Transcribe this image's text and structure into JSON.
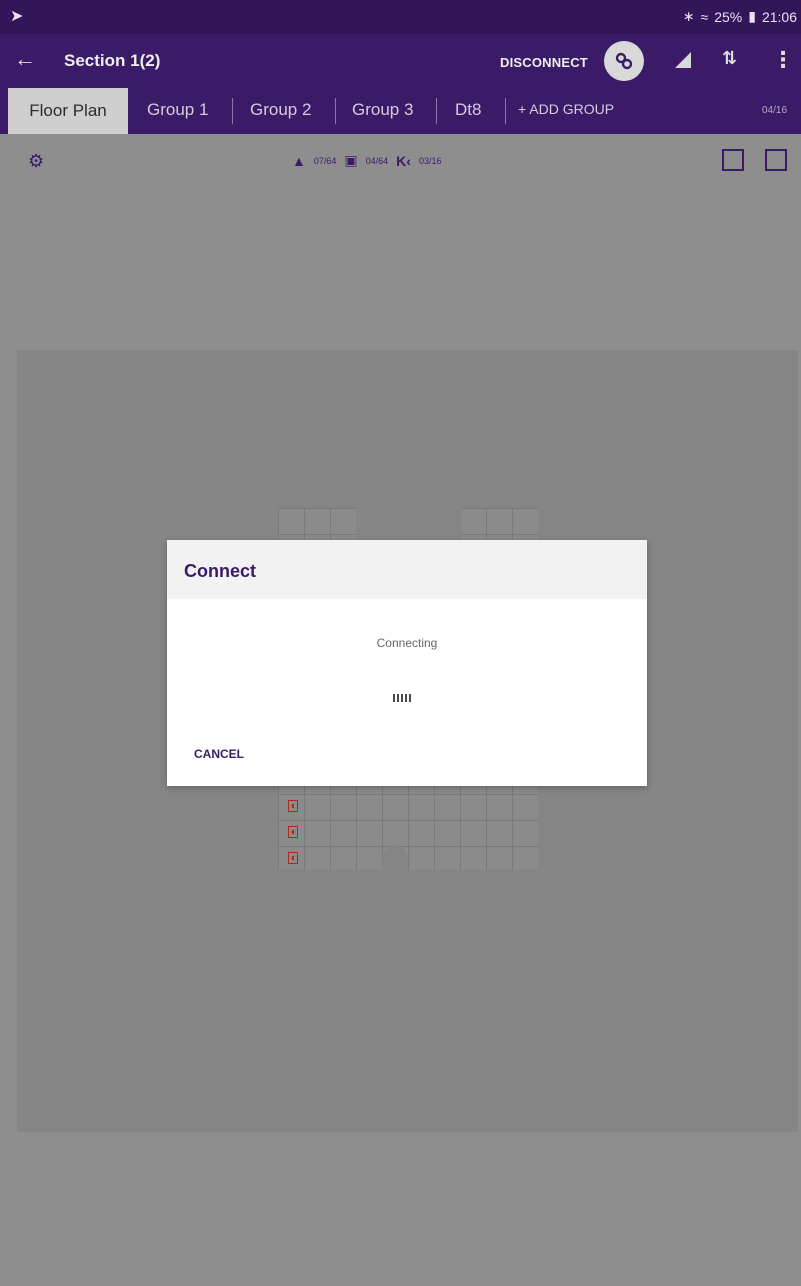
{
  "status_bar": {
    "left_icon": "send-icon",
    "battery_percent": "25%",
    "time": "21:06",
    "icons": [
      "bluetooth-icon",
      "wifi-icon",
      "battery-icon"
    ]
  },
  "app_bar": {
    "back_icon": "arrow-left-icon",
    "title": "Section 1(2)",
    "disconnect_label": "DISCONNECT",
    "link_icon": "link-icon",
    "signal_icon": "signal-icon",
    "sort_icon": "sort-icon",
    "more_icon": "more-vert-icon"
  },
  "tabs": {
    "items": [
      {
        "label": "Floor Plan",
        "active": true
      },
      {
        "label": "Group 1",
        "active": false
      },
      {
        "label": "Group 2",
        "active": false
      },
      {
        "label": "Group 3",
        "active": false
      },
      {
        "label": "Dt8",
        "active": false
      }
    ],
    "add_label": "+ ADD GROUP",
    "count": "04/16"
  },
  "toolbar": {
    "settings_icon": "gear-icon",
    "stats": [
      {
        "icon": "ceiling-light-icon",
        "value": "07/64"
      },
      {
        "icon": "device-box-icon",
        "value": "04/64"
      },
      {
        "icon": "sensor-icon",
        "value": "03/16"
      }
    ],
    "fit_icon": "fit-screen-icon",
    "edit_icon": "edit-box-icon"
  },
  "dialog": {
    "title": "Connect",
    "message": "Connecting",
    "loader_text": "IIIII",
    "cancel_label": "CANCEL"
  },
  "colors": {
    "primary": "#3b1b68",
    "status_bar": "#33165a",
    "dim_overlay": "#8e8e8e",
    "marker_red": "#b3261e"
  }
}
